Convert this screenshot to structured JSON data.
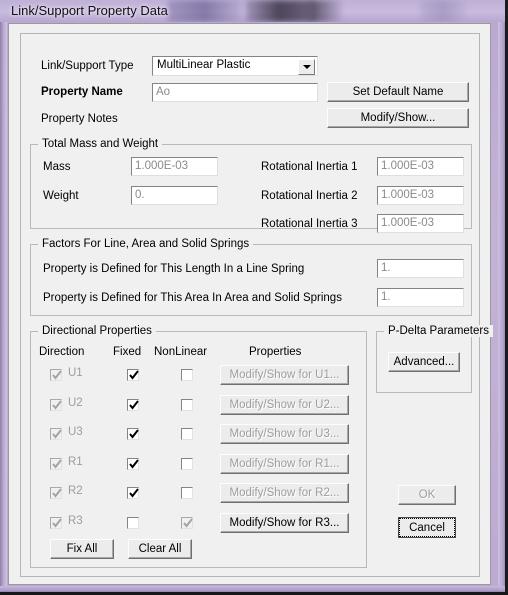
{
  "window": {
    "title": "Link/Support Property Data"
  },
  "top_section": {
    "link_support_type_label": "Link/Support Type",
    "link_support_type_value": "MultiLinear Plastic",
    "property_name_label": "Property Name",
    "property_name_value": "Ao",
    "property_notes_label": "Property Notes",
    "set_default_name_button": "Set Default Name",
    "modify_show_button": "Modify/Show..."
  },
  "mass_weight": {
    "group_title": "Total Mass and Weight",
    "mass_label": "Mass",
    "mass_value": "1.000E-03",
    "weight_label": "Weight",
    "weight_value": "0.",
    "rot_inertia_1_label": "Rotational Inertia 1",
    "rot_inertia_1_value": "1.000E-03",
    "rot_inertia_2_label": "Rotational Inertia 2",
    "rot_inertia_2_value": "1.000E-03",
    "rot_inertia_3_label": "Rotational Inertia 3",
    "rot_inertia_3_value": "1.000E-03"
  },
  "factors": {
    "group_title": "Factors For Line, Area and Solid Springs",
    "length_label": "Property is Defined for This Length In a Line Spring",
    "length_value": "1.",
    "area_label": "Property is Defined for This Area In Area and Solid Springs",
    "area_value": "1."
  },
  "directional": {
    "group_title": "Directional Properties",
    "headers": {
      "direction": "Direction",
      "fixed": "Fixed",
      "nonlinear": "NonLinear",
      "properties": "Properties"
    },
    "rows": [
      {
        "direction": "U1",
        "dir_checked": true,
        "dir_disabled": true,
        "fixed_checked": true,
        "fixed_disabled": false,
        "nonlinear_checked": false,
        "nonlinear_disabled": false,
        "button": "Modify/Show for U1...",
        "button_disabled": true
      },
      {
        "direction": "U2",
        "dir_checked": true,
        "dir_disabled": true,
        "fixed_checked": true,
        "fixed_disabled": false,
        "nonlinear_checked": false,
        "nonlinear_disabled": false,
        "button": "Modify/Show for U2...",
        "button_disabled": true
      },
      {
        "direction": "U3",
        "dir_checked": true,
        "dir_disabled": true,
        "fixed_checked": true,
        "fixed_disabled": false,
        "nonlinear_checked": false,
        "nonlinear_disabled": false,
        "button": "Modify/Show for U3...",
        "button_disabled": true
      },
      {
        "direction": "R1",
        "dir_checked": true,
        "dir_disabled": true,
        "fixed_checked": true,
        "fixed_disabled": false,
        "nonlinear_checked": false,
        "nonlinear_disabled": false,
        "button": "Modify/Show for R1...",
        "button_disabled": true
      },
      {
        "direction": "R2",
        "dir_checked": true,
        "dir_disabled": true,
        "fixed_checked": true,
        "fixed_disabled": false,
        "nonlinear_checked": false,
        "nonlinear_disabled": false,
        "button": "Modify/Show for R2...",
        "button_disabled": true
      },
      {
        "direction": "R3",
        "dir_checked": true,
        "dir_disabled": true,
        "fixed_checked": false,
        "fixed_disabled": false,
        "nonlinear_checked": true,
        "nonlinear_disabled": true,
        "button": "Modify/Show for R3...",
        "button_disabled": false
      }
    ],
    "fix_all_button": "Fix All",
    "clear_all_button": "Clear All"
  },
  "pdelta": {
    "group_title": "P-Delta Parameters",
    "advanced_button": "Advanced..."
  },
  "actions": {
    "ok_button": "OK",
    "cancel_button": "Cancel"
  },
  "colors": {
    "frame": "#bcaad2",
    "dialog_bg": "#f0f0f0",
    "disabled_text": "#9d9d9d",
    "field_text": "#8a8a8a"
  }
}
